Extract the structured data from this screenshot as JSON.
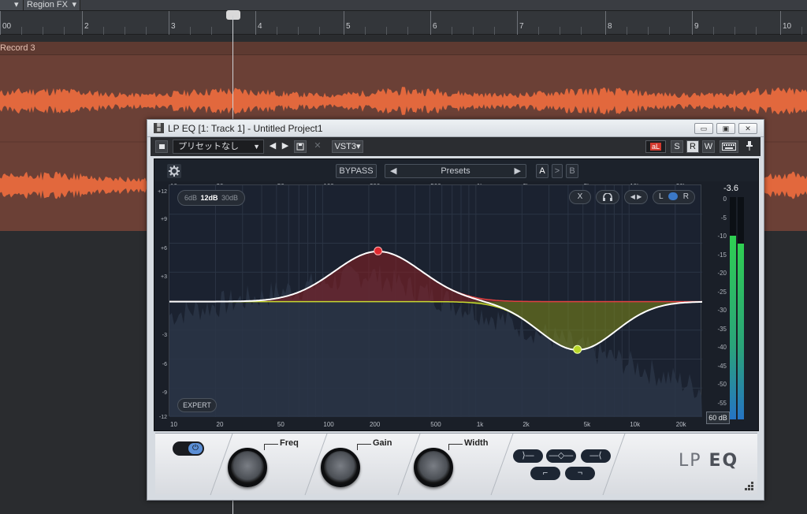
{
  "daw": {
    "topbar": {
      "dropdown1_arrow": "▾",
      "dropdown2": "Region FX",
      "dropdown2_arrow": "▾"
    },
    "ruler": {
      "ticks": [
        "00",
        "2",
        "3",
        "4",
        "5",
        "6",
        "7",
        "8",
        "9",
        "10"
      ]
    },
    "track": {
      "name": "Record 3"
    }
  },
  "plugin": {
    "title": "LP EQ [1: Track 1] - Untitled Project1",
    "titlebar_icon": "icon",
    "window_buttons": {
      "minimize": "▭",
      "restore": "▣",
      "close": "✕"
    },
    "toolbar": {
      "preset_value": "プリセットなし",
      "prev": "◀",
      "next": "▶",
      "save_icon": "save-icon",
      "disabled_x": "✕",
      "format": "VST3▾",
      "auto_label": "aL",
      "s": "S",
      "r": "R",
      "w": "W",
      "keyboard_icon": "keyboard-icon",
      "pin_icon": "pin-icon"
    },
    "eq": {
      "bypass": "BYPASS",
      "presets": "Presets",
      "preset_prev": "◀",
      "preset_next": "▶",
      "ab_a": "A",
      "ab_copy": ">",
      "ab_b": "B",
      "slope_options": [
        "6dB",
        "12dB",
        "30dB"
      ],
      "slope_selected": "12dB",
      "band_x": "X",
      "band_l": "L",
      "band_r": "R",
      "expert": "EXPERT",
      "freq_labels": [
        "10",
        "20",
        "50",
        "100",
        "200",
        "500",
        "1k",
        "2k",
        "5k",
        "10k",
        "20k"
      ],
      "db_labels": [
        "+12",
        "+9",
        "+6",
        "+3",
        "-3",
        "-6",
        "-9",
        "-12"
      ],
      "meter_peak": "-3.6",
      "meter_scale": [
        "0",
        "-5",
        "-10",
        "-15",
        "-20",
        "-25",
        "-30",
        "-35",
        "-40",
        "-45",
        "-50",
        "-55",
        "-60"
      ],
      "meter_range": "60 dB"
    },
    "controls": {
      "freq": "Freq",
      "gain": "Gain",
      "width": "Width",
      "brand": "LP",
      "brand_bold": "EQ"
    }
  }
}
